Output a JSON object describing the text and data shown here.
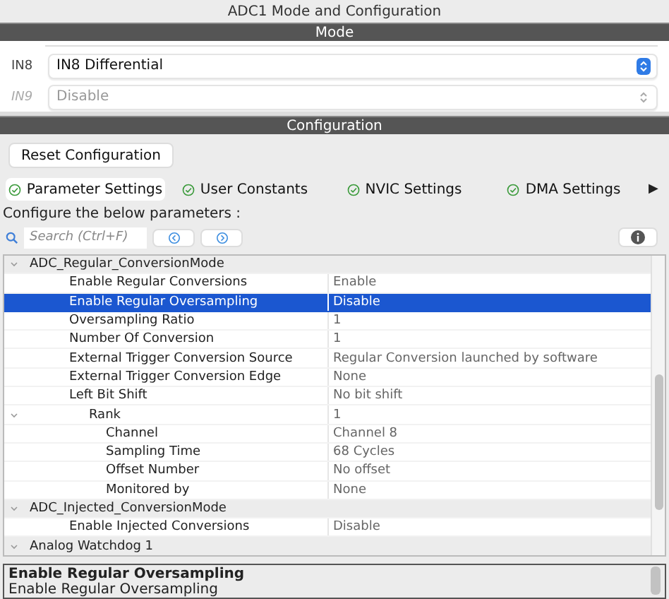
{
  "window": {
    "title": "ADC1 Mode and Configuration"
  },
  "mode": {
    "title": "Mode",
    "fields": [
      {
        "label": "IN8",
        "value": "IN8 Differential",
        "disabled": false
      },
      {
        "label": "IN9",
        "value": "Disable",
        "disabled": true
      }
    ]
  },
  "configuration": {
    "title": "Configuration",
    "reset_button": "Reset Configuration",
    "tabs": [
      {
        "label": "Parameter Settings",
        "selected": true
      },
      {
        "label": "User Constants",
        "selected": false
      },
      {
        "label": "NVIC Settings",
        "selected": false
      },
      {
        "label": "DMA Settings",
        "selected": false
      }
    ],
    "tabs_more": "▶",
    "instruction": "Configure the below parameters :",
    "search": {
      "placeholder": "Search (Ctrl+F)"
    },
    "tree": [
      {
        "name": "ADC_Regular_ConversionMode",
        "expanded": true,
        "children": [
          {
            "name": "Enable Regular Conversions",
            "value": "Enable",
            "selected": false
          },
          {
            "name": "Enable Regular Oversampling",
            "value": "Disable",
            "selected": true
          },
          {
            "name": "Oversampling Ratio",
            "value": "1",
            "selected": false
          },
          {
            "name": "Number Of Conversion",
            "value": "1",
            "selected": false
          },
          {
            "name": "External Trigger Conversion Source",
            "value": "Regular Conversion launched by software",
            "selected": false
          },
          {
            "name": "External Trigger Conversion Edge",
            "value": "None",
            "selected": false
          },
          {
            "name": "Left Bit Shift",
            "value": "No bit shift",
            "selected": false
          },
          {
            "name": "Rank",
            "value": "1",
            "selected": false,
            "expanded": true,
            "children": [
              {
                "name": "Channel",
                "value": "Channel 8",
                "selected": false
              },
              {
                "name": "Sampling Time",
                "value": "68 Cycles",
                "selected": false
              },
              {
                "name": "Offset Number",
                "value": "No offset",
                "selected": false
              },
              {
                "name": "Monitored by",
                "value": "None",
                "selected": false
              }
            ]
          }
        ]
      },
      {
        "name": "ADC_Injected_ConversionMode",
        "expanded": true,
        "children": [
          {
            "name": "Enable Injected Conversions",
            "value": "Disable",
            "selected": false
          }
        ]
      },
      {
        "name": "Analog Watchdog 1",
        "expanded": true
      }
    ],
    "description": {
      "title": "Enable Regular Oversampling",
      "text": "Enable Regular Oversampling"
    }
  }
}
